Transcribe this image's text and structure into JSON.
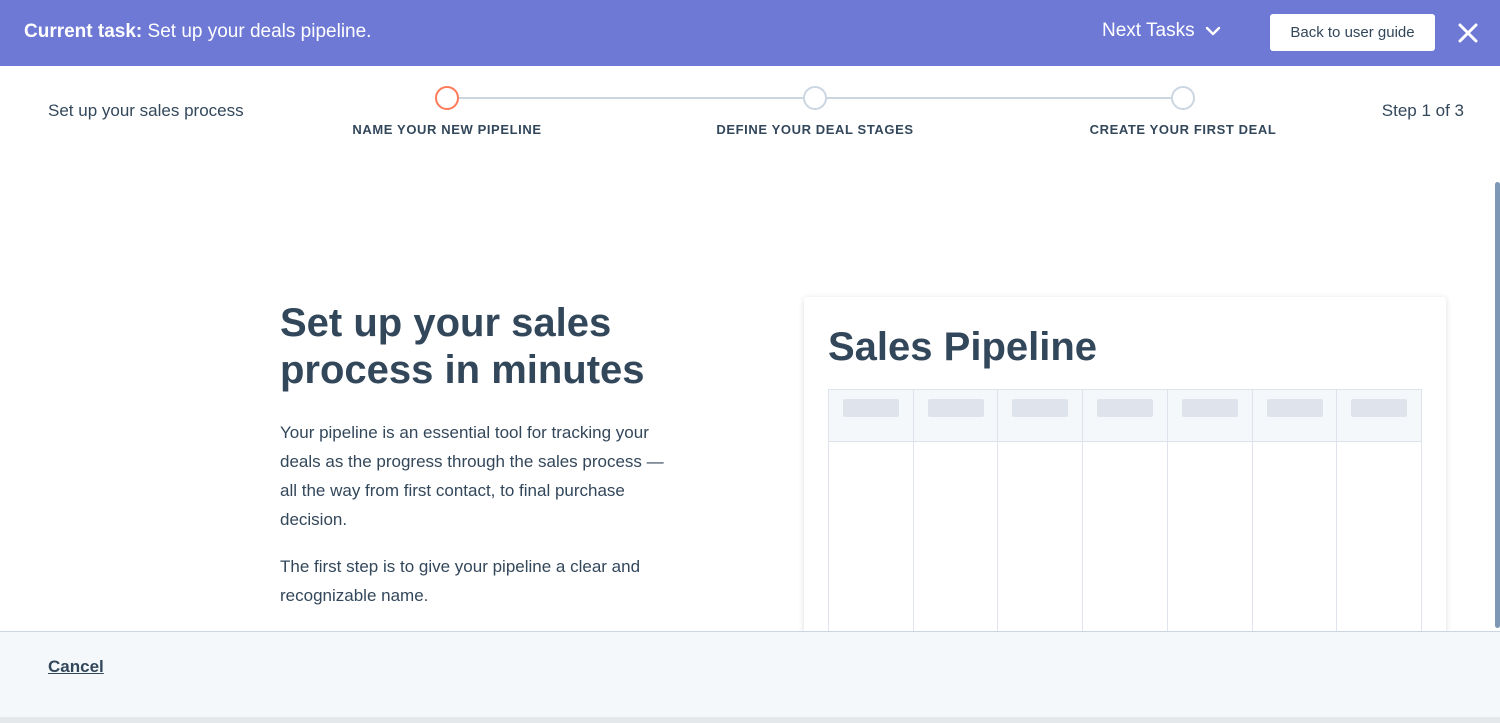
{
  "topbar": {
    "task_label": "Current task:",
    "task_text": " Set up your deals pipeline.",
    "next_tasks": "Next Tasks",
    "back_button": "Back to user guide",
    "close_icon": "close-icon",
    "chevron_icon": "chevron-down-icon"
  },
  "header": {
    "subtitle": "Set up your sales process",
    "step_counter": "Step 1 of 3"
  },
  "steps": [
    {
      "label": "NAME YOUR NEW PIPELINE",
      "active": true
    },
    {
      "label": "DEFINE YOUR DEAL STAGES",
      "active": false
    },
    {
      "label": "CREATE YOUR FIRST DEAL",
      "active": false
    }
  ],
  "intro": {
    "heading": "Set up your sales process in minutes",
    "paragraph1": "Your pipeline is an essential tool for tracking your deals as the progress through the sales process — all the way from first contact, to final purchase decision.",
    "paragraph2": "The first step is to give your pipeline a clear and recognizable name."
  },
  "preview": {
    "title": "Sales Pipeline",
    "column_count": 7
  },
  "footer": {
    "cancel": "Cancel"
  },
  "colors": {
    "topbar": "#6e79d6",
    "active_step": "#ff7a59",
    "text": "#33475b"
  }
}
